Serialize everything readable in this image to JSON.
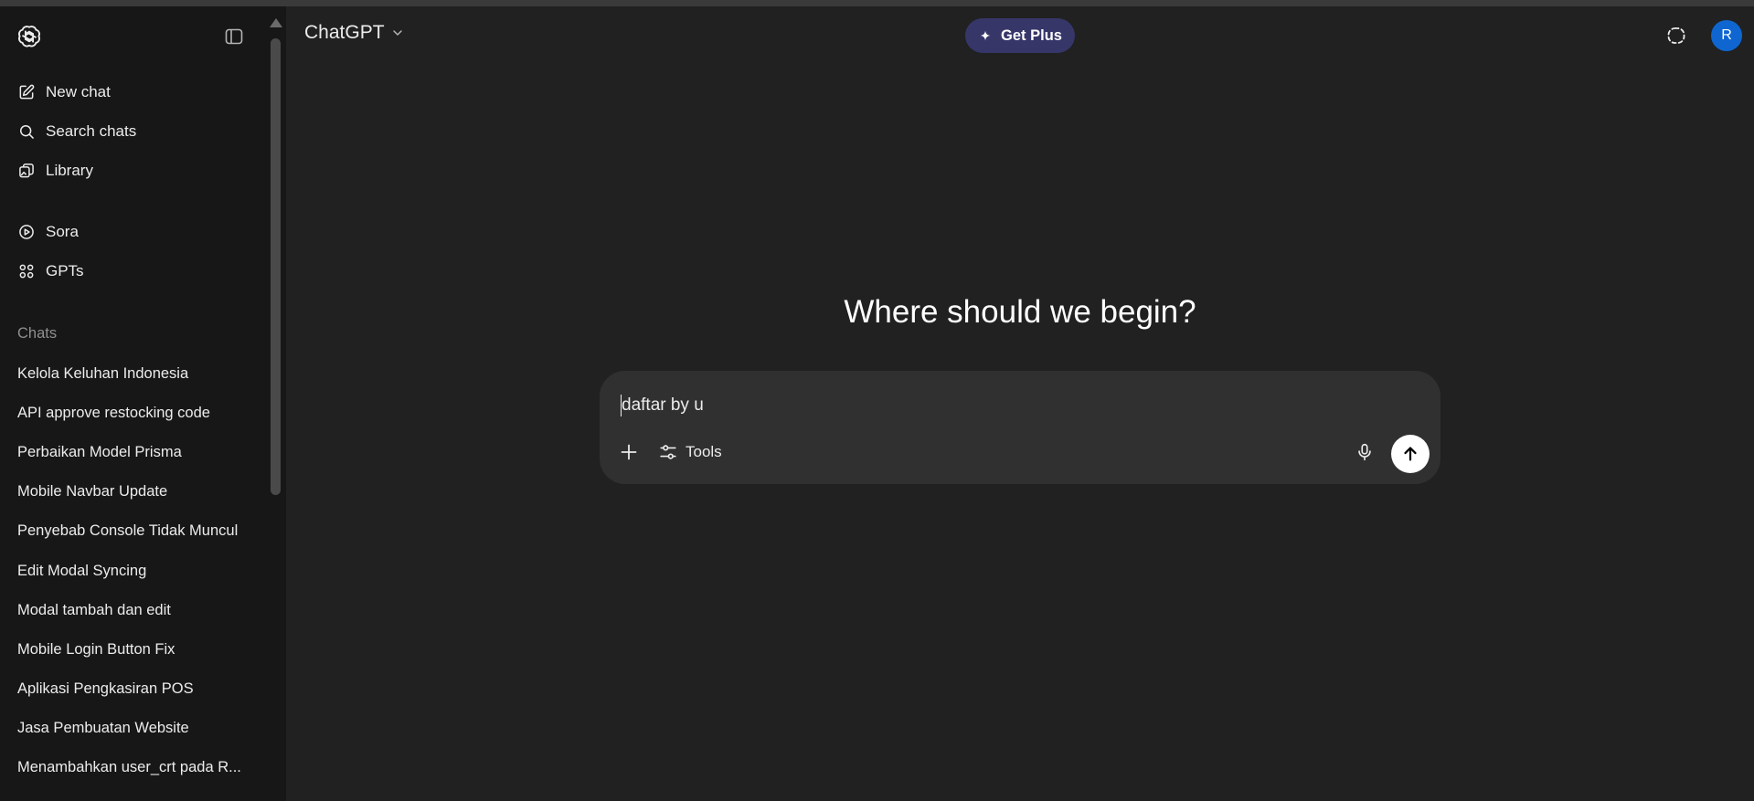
{
  "header": {
    "model_name": "ChatGPT",
    "get_plus_label": "Get Plus",
    "avatar_initial": "R"
  },
  "sidebar": {
    "nav": [
      {
        "label": "New chat",
        "icon": "edit-icon"
      },
      {
        "label": "Search chats",
        "icon": "search-icon"
      },
      {
        "label": "Library",
        "icon": "library-icon"
      },
      {
        "label": "Sora",
        "icon": "play-icon"
      },
      {
        "label": "GPTs",
        "icon": "grid-icon"
      }
    ],
    "chats_heading": "Chats",
    "chats": [
      "Kelola Keluhan Indonesia",
      "API approve restocking code",
      "Perbaikan Model Prisma",
      "Mobile Navbar Update",
      "Penyebab Console Tidak Muncul",
      "Edit Modal Syncing",
      "Modal tambah dan edit",
      "Mobile Login Button Fix",
      "Aplikasi Pengkasiran POS",
      "Jasa Pembuatan Website",
      "Menambahkan user_crt pada R..."
    ]
  },
  "main": {
    "headline": "Where should we begin?",
    "composer": {
      "value": "daftar by u",
      "tools_label": "Tools"
    }
  },
  "colors": {
    "background": "#212121",
    "sidebar": "#171717",
    "composer": "#303030",
    "get_plus": "#373669",
    "avatar": "#0f66d0"
  }
}
